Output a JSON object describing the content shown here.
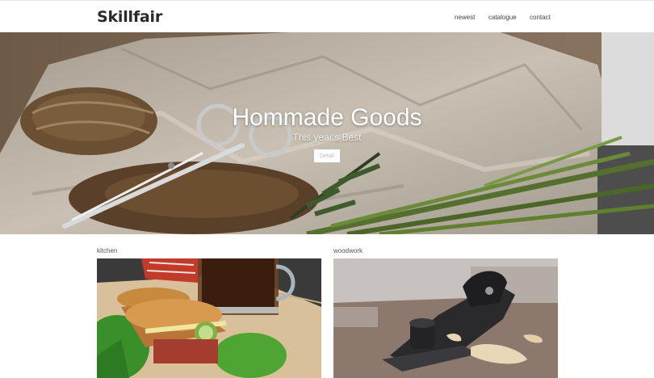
{
  "site": {
    "logo": "Skillfair"
  },
  "nav": {
    "items": [
      {
        "label": "newest"
      },
      {
        "label": "catalogue"
      },
      {
        "label": "contact"
      }
    ]
  },
  "hero": {
    "title": "Hommade Goods",
    "subtitle": "This year's Best",
    "button_label": "Detail"
  },
  "cards": [
    {
      "label": "kitchen"
    },
    {
      "label": "woodwork"
    }
  ]
}
